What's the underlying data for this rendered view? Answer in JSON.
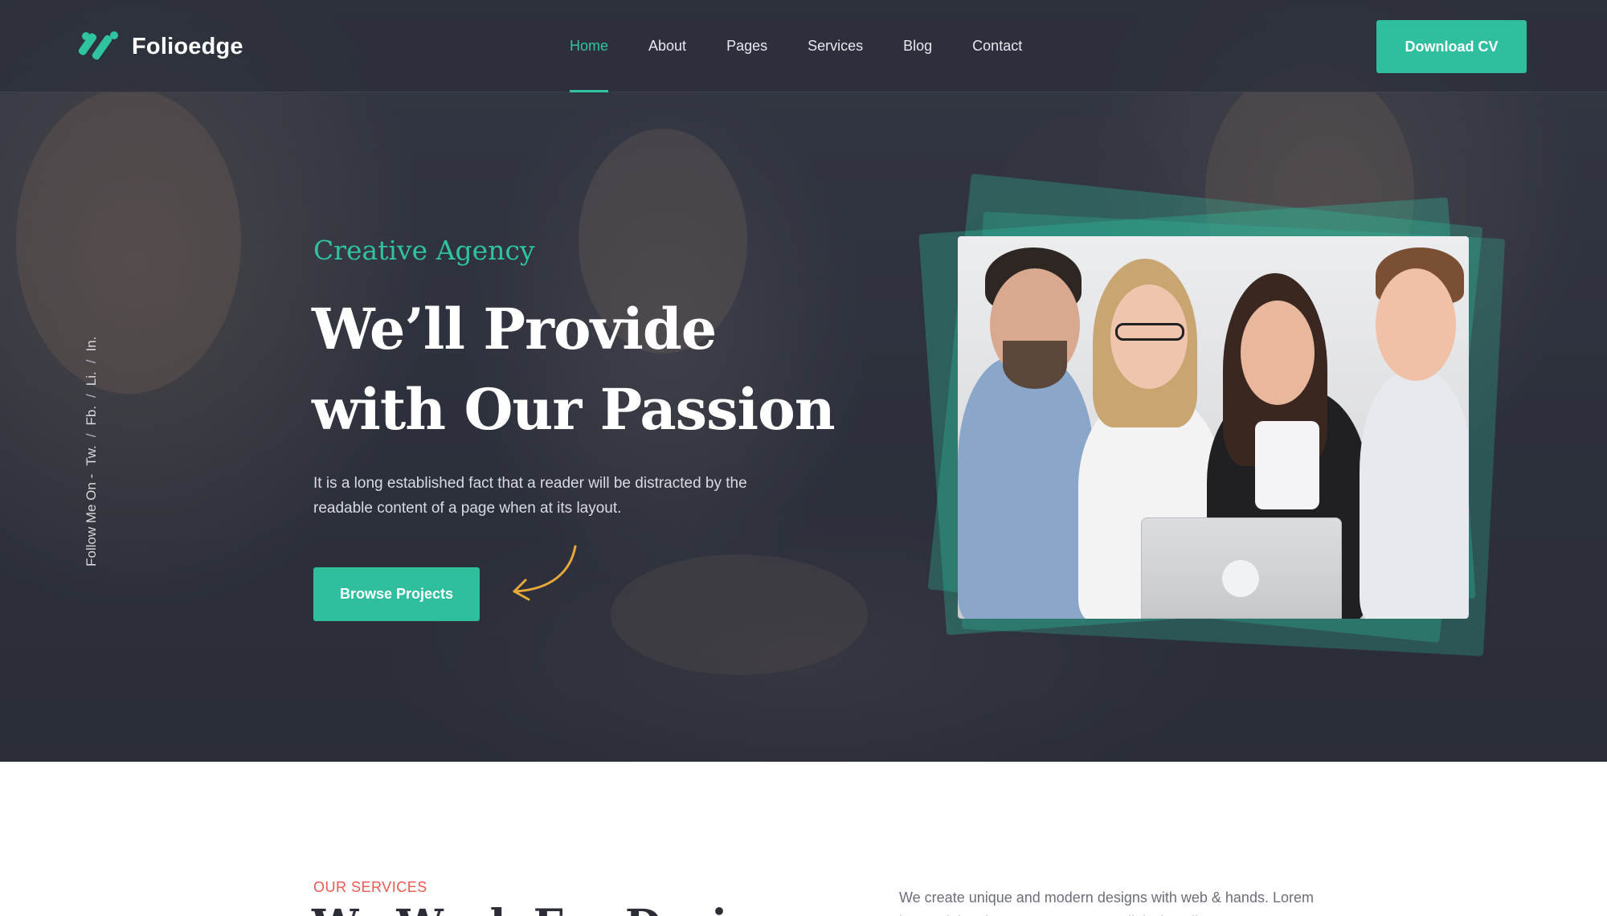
{
  "brand": {
    "name": "Folioedge",
    "accent": "#2fc3a2",
    "logo_icon": "slash-stripes-icon"
  },
  "nav": {
    "items": [
      {
        "label": "Home",
        "active": true
      },
      {
        "label": "About",
        "active": false
      },
      {
        "label": "Pages",
        "active": false
      },
      {
        "label": "Services",
        "active": false
      },
      {
        "label": "Blog",
        "active": false
      },
      {
        "label": "Contact",
        "active": false
      }
    ],
    "cta_label": "Download CV"
  },
  "social": {
    "prefix": "Follow Me On -",
    "links": [
      "Tw.",
      "Fb.",
      "Li.",
      "In."
    ],
    "separator": "/"
  },
  "hero": {
    "eyebrow": "Creative Agency",
    "title_line1": "We’ll Provide",
    "title_line2": "with Our Passion",
    "description": "It is a long established fact that a reader will be distracted by the readable content of a page when at its layout.",
    "button_label": "Browse Projects",
    "arrow_icon": "curved-arrow-icon",
    "arrow_color": "#e8a93a",
    "image_icon": "team-meeting-photo"
  },
  "services": {
    "eyebrow": "OUR SERVICES",
    "eyebrow_color": "#f0574f",
    "title": "We Work For Design",
    "description": "We create unique and modern designs with web & hands. Lorem ipsum dolor sit amet, consectetur adipiscing elit."
  }
}
